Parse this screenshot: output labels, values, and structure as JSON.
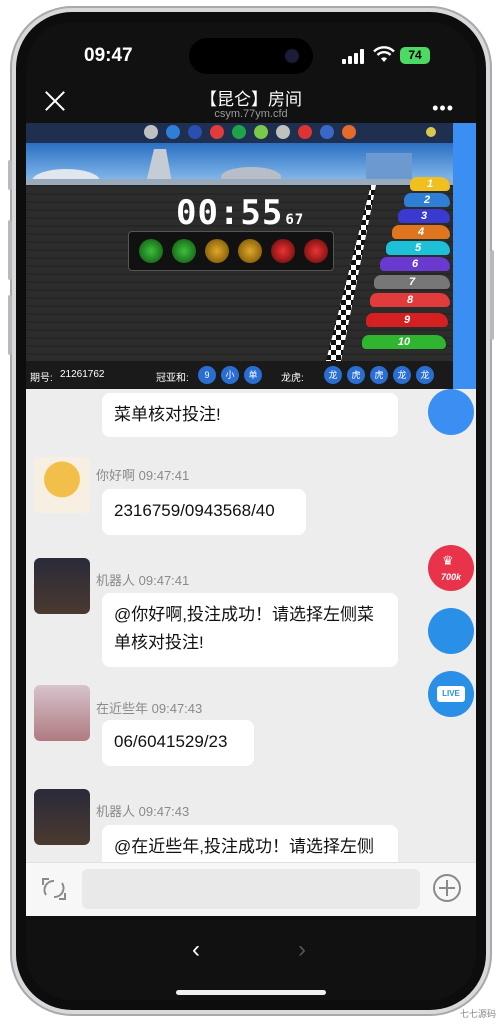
{
  "status": {
    "time": "09:47",
    "battery": "74"
  },
  "nav": {
    "title": "【昆仑】房间",
    "subtitle": "csym.77ym.cfd"
  },
  "game": {
    "timer_main": "00:55",
    "timer_small": "67",
    "period_label": "期号:",
    "period_value": "21261762",
    "sum_label": "冠亚和:",
    "sum_values": [
      "9",
      "小",
      "单"
    ],
    "dragon_label": "龙虎:",
    "dragon_values": [
      "龙",
      "虎",
      "虎",
      "龙",
      "龙"
    ],
    "car_numbers": [
      "1",
      "2",
      "3",
      "4",
      "5",
      "6",
      "7",
      "8",
      "9",
      "10"
    ]
  },
  "chat": [
    {
      "text": "菜单核对投注!"
    },
    {
      "user": "你好啊",
      "time": "09:47:41",
      "text": "2316759/0943568/40"
    },
    {
      "user": "机器人",
      "time": "09:47:41",
      "text": "@你好啊,投注成功！请选择左侧菜单核对投注!"
    },
    {
      "user": "在近些年",
      "time": "09:47:43",
      "text": "06/6041529/23"
    },
    {
      "user": "机器人",
      "time": "09:47:43",
      "text": "@在近些年,投注成功！请选择左侧"
    }
  ],
  "fab": {
    "badge": "700k",
    "live": "LIVE"
  },
  "watermark": "七七源码",
  "icons": [
    "close-icon",
    "more-icon",
    "switch-icon",
    "plus-icon",
    "back-icon",
    "forward-icon",
    "wifi-icon",
    "signal-icon"
  ]
}
